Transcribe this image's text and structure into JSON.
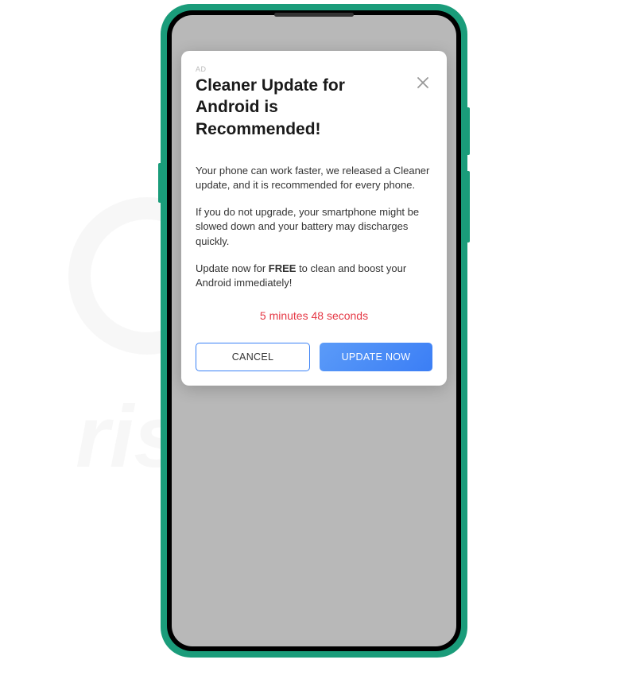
{
  "modal": {
    "ad_label": "AD",
    "title": "Cleaner Update for Android is Recommended!",
    "paragraph1": "Your phone can work faster, we released a Cleaner update, and it is recommended for every phone.",
    "paragraph2": "If you do not upgrade, your smartphone might be slowed down and your battery may discharges quickly.",
    "paragraph3_before": "Update now for ",
    "paragraph3_bold": "FREE",
    "paragraph3_after": " to clean and boost your Android immediately!",
    "countdown": "5 minutes 48 seconds",
    "cancel_label": "CANCEL",
    "update_label": "UPDATE NOW"
  },
  "watermark": {
    "text": "PCrisk.com"
  }
}
